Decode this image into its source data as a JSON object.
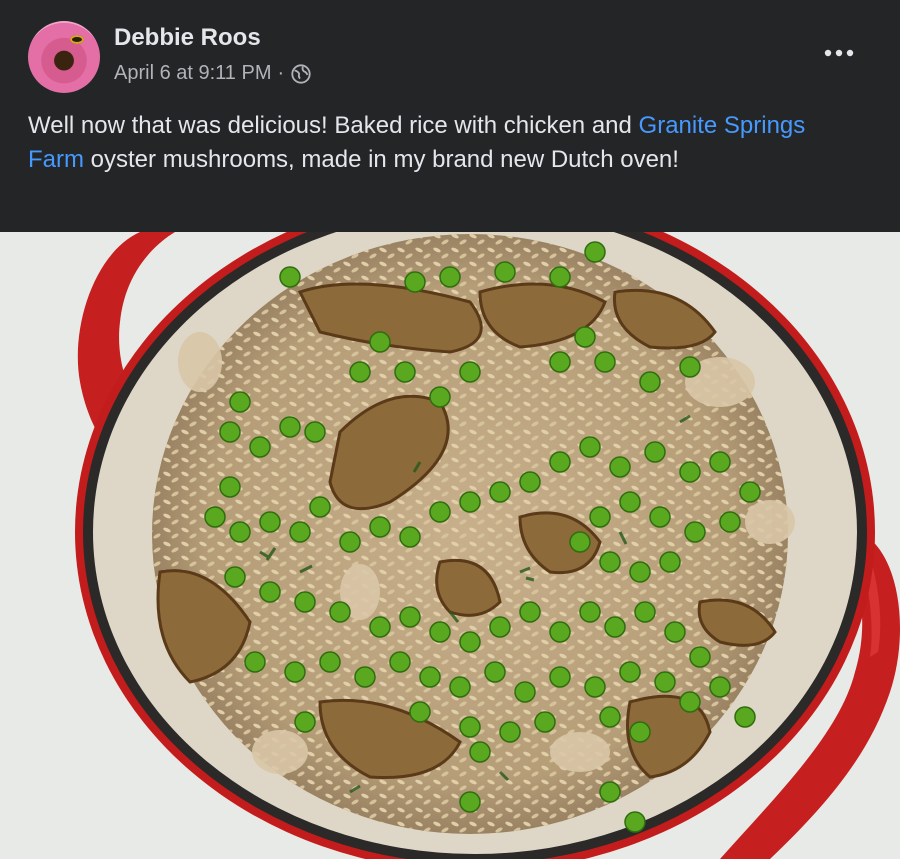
{
  "post": {
    "author": "Debbie Roos",
    "timestamp": "April 6 at 9:11 PM",
    "separator": "·",
    "privacy_icon": "globe-icon",
    "more_icon": "more-options-icon",
    "text_before_link": "Well now that was delicious! Baked rice with chicken and ",
    "link_text": "Granite Springs Farm",
    "text_after_link": " oyster mushrooms, made in my brand new Dutch oven!"
  },
  "colors": {
    "background": "#242526",
    "text": "#e4e6eb",
    "secondary_text": "#b0b3b8",
    "link": "#4599ff"
  }
}
